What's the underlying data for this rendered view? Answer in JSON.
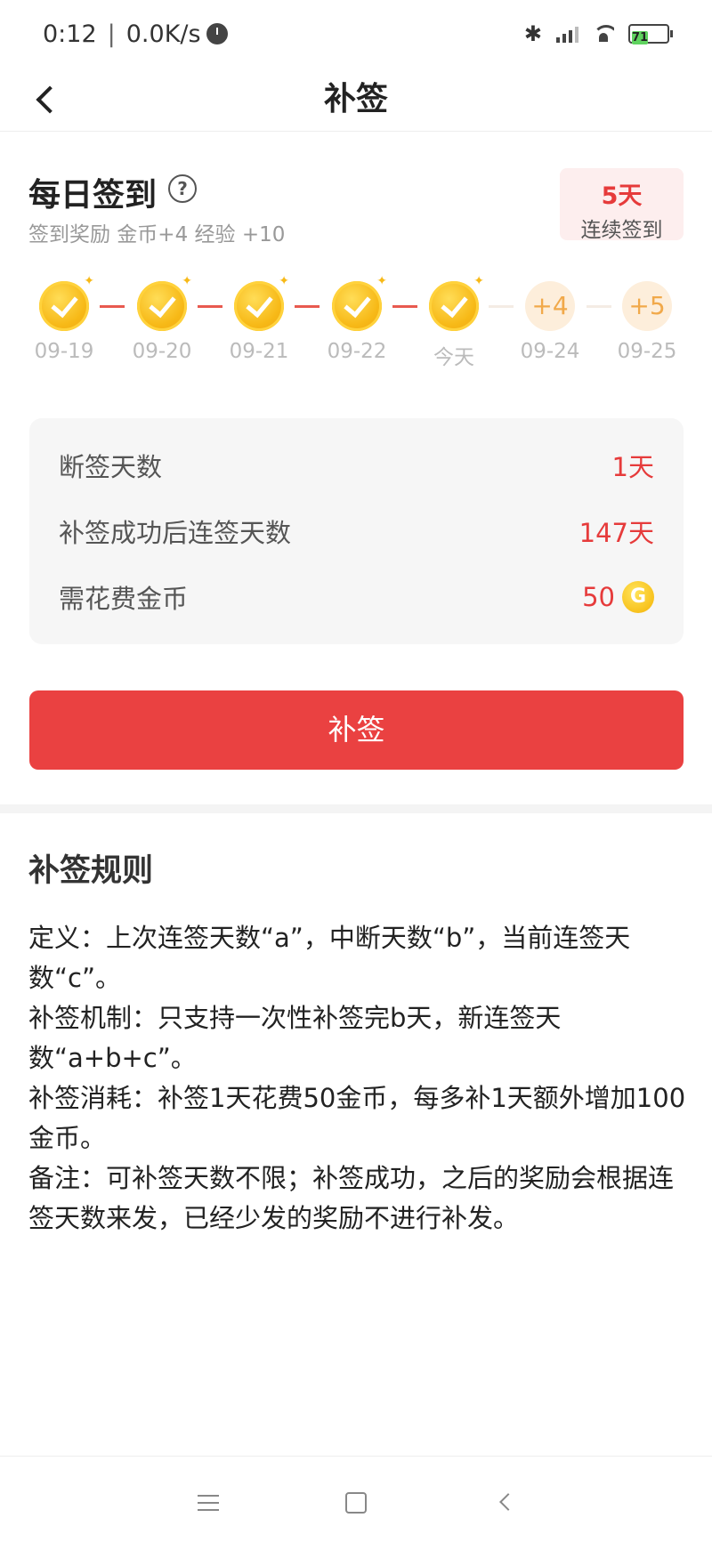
{
  "status_bar": {
    "time": "0:12",
    "separator": "|",
    "net_speed": "0.0K/s",
    "battery_level": "71"
  },
  "nav": {
    "title": "补签"
  },
  "checkin": {
    "title": "每日签到",
    "help_symbol": "?",
    "reward_text": "签到奖励 金币+4 经验 +10",
    "streak_days": "5天",
    "streak_label": "连续签到"
  },
  "timeline": [
    {
      "date": "09-19",
      "state": "done"
    },
    {
      "date": "09-20",
      "state": "done"
    },
    {
      "date": "09-21",
      "state": "done"
    },
    {
      "date": "09-22",
      "state": "done"
    },
    {
      "date": "今天",
      "state": "done"
    },
    {
      "date": "09-24",
      "state": "future",
      "reward": "+4"
    },
    {
      "date": "09-25",
      "state": "future",
      "reward": "+5"
    }
  ],
  "info": {
    "missed_label": "断签天数",
    "missed_value": "1天",
    "after_label": "补签成功后连签天数",
    "after_value": "147天",
    "cost_label": "需花费金币",
    "cost_value": "50",
    "coin_symbol": "G"
  },
  "action": {
    "button_label": "补签"
  },
  "rules": {
    "title": "补签规则",
    "lines": [
      "定义：上次连签天数“a”，中断天数“b”，当前连签天数“c”。",
      "补签机制：只支持一次性补签完b天，新连签天数“a+b+c”。",
      "补签消耗：补签1天花费50金币，每多补1天额外增加100金币。",
      "备注：可补签天数不限；补签成功，之后的奖励会根据连签天数来发，已经少发的奖励不进行补发。"
    ]
  },
  "colors": {
    "accent": "#ea4141",
    "value_red": "#e63b3b",
    "coin_gold": "#f7b917",
    "future_coin": "#fdeedb"
  }
}
